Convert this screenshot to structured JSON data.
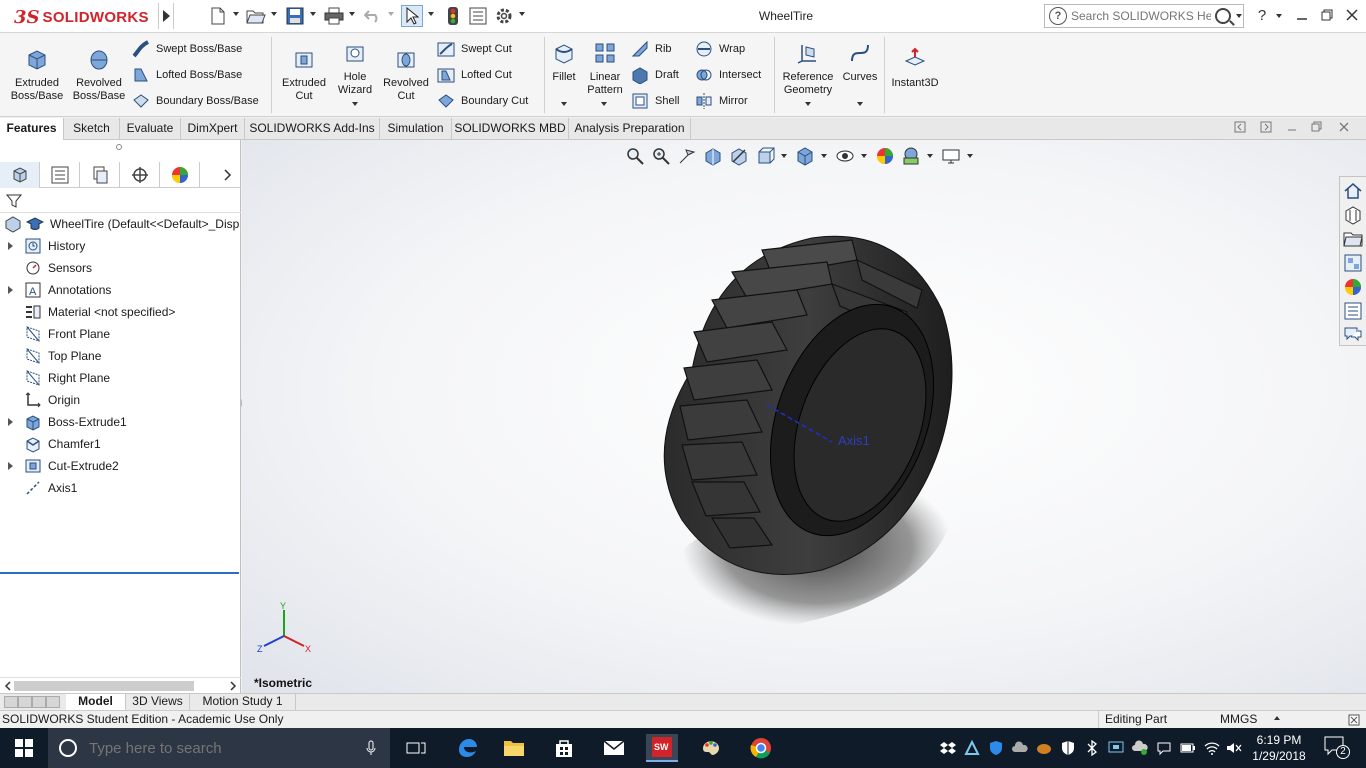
{
  "app": {
    "brand": "SOLIDWORKS",
    "document_title": "WheelTire",
    "search_placeholder": "Search SOLIDWORKS Help",
    "help_label": "?"
  },
  "ribbon": {
    "extruded_boss": "Extruded Boss/Base",
    "revolved_boss": "Revolved Boss/Base",
    "swept_boss": "Swept Boss/Base",
    "lofted_boss": "Lofted Boss/Base",
    "boundary_boss": "Boundary Boss/Base",
    "extruded_cut": "Extruded Cut",
    "hole_wizard": "Hole Wizard",
    "revolved_cut": "Revolved Cut",
    "swept_cut": "Swept Cut",
    "lofted_cut": "Lofted Cut",
    "boundary_cut": "Boundary Cut",
    "fillet": "Fillet",
    "linear_pattern": "Linear Pattern",
    "rib": "Rib",
    "draft": "Draft",
    "shell": "Shell",
    "wrap": "Wrap",
    "intersect": "Intersect",
    "mirror": "Mirror",
    "reference_geometry": "Reference Geometry",
    "curves": "Curves",
    "instant3d": "Instant3D"
  },
  "command_tabs": [
    "Features",
    "Sketch",
    "Evaluate",
    "DimXpert",
    "SOLIDWORKS Add-Ins",
    "Simulation",
    "SOLIDWORKS MBD",
    "Analysis Preparation"
  ],
  "feature_tree": {
    "root": "WheelTire  (Default<<Default>_Disp",
    "items": [
      {
        "label": "History",
        "expandable": true,
        "icon": "history-icon"
      },
      {
        "label": "Sensors",
        "expandable": false,
        "icon": "sensors-icon"
      },
      {
        "label": "Annotations",
        "expandable": true,
        "icon": "annotations-icon"
      },
      {
        "label": "Material <not specified>",
        "expandable": false,
        "icon": "material-icon"
      },
      {
        "label": "Front Plane",
        "expandable": false,
        "icon": "plane-icon"
      },
      {
        "label": "Top Plane",
        "expandable": false,
        "icon": "plane-icon"
      },
      {
        "label": "Right Plane",
        "expandable": false,
        "icon": "plane-icon"
      },
      {
        "label": "Origin",
        "expandable": false,
        "icon": "origin-icon"
      },
      {
        "label": "Boss-Extrude1",
        "expandable": true,
        "icon": "extrude-icon"
      },
      {
        "label": "Chamfer1",
        "expandable": false,
        "icon": "chamfer-icon"
      },
      {
        "label": "Cut-Extrude2",
        "expandable": true,
        "icon": "cut-extrude-icon"
      },
      {
        "label": "Axis1",
        "expandable": false,
        "icon": "axis-icon"
      }
    ]
  },
  "viewport": {
    "view_name": "*Isometric",
    "axis_label": "Axis1",
    "triad": {
      "x": "X",
      "y": "Y",
      "z": "Z"
    }
  },
  "bottom_tabs": [
    "Model",
    "3D Views",
    "Motion Study 1"
  ],
  "status": {
    "left": "SOLIDWORKS Student Edition - Academic Use Only",
    "mode": "Editing Part",
    "units": "MMGS"
  },
  "taskbar": {
    "search_placeholder": "Type here to search",
    "time": "6:19 PM",
    "date": "1/29/2018",
    "notifications": "2"
  },
  "colors": {
    "brand_red": "#d2232a",
    "selection_blue": "#2b6fc0",
    "taskbar_bg": "#101b2a"
  }
}
